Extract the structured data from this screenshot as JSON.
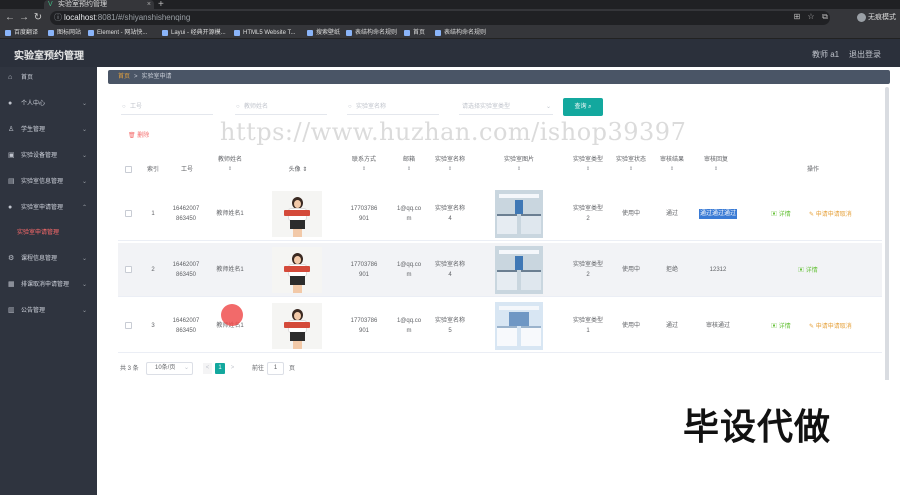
{
  "browser": {
    "tab_title": "实验室预约管理",
    "tab_close": "×",
    "new_tab": "+",
    "url_host": "localhost",
    "url_path": ":8081/#/shiyanshishenqing",
    "profile_label": "无痕模式",
    "bookmarks": [
      "百度翻译",
      "图标网站",
      "Element - 网站快...",
      "Layui - 经典开源模...",
      "HTML5 Website T...",
      "搜索壁纸",
      "表结构命名规则",
      "首页",
      "表结构命名规则"
    ]
  },
  "header": {
    "app_title": "实验室预约管理",
    "user_name": "教师 a1",
    "logout": "退出登录"
  },
  "sidebar": {
    "items": [
      {
        "label": "首页",
        "icon": "home-icon"
      },
      {
        "label": "个人中心",
        "icon": "user-icon"
      },
      {
        "label": "学生管理",
        "icon": "student-icon"
      },
      {
        "label": "实验设备管理",
        "icon": "device-icon"
      },
      {
        "label": "实验室信息管理",
        "icon": "lab-info-icon"
      },
      {
        "label": "实验室申请管理",
        "icon": "lab-apply-icon"
      },
      {
        "label": "课程信息管理",
        "icon": "course-icon"
      },
      {
        "label": "排课取消申请管理",
        "icon": "cancel-icon"
      },
      {
        "label": "公告管理",
        "icon": "notice-icon"
      }
    ],
    "active_sub": "实验室申请管理"
  },
  "breadcrumb": {
    "home": "首页",
    "sep": ">",
    "current": "实验室申请"
  },
  "filters": {
    "job_no": "工号",
    "teacher_name": "教师姓名",
    "lab_name": "实验室名称",
    "lab_type": "请选择实验室类型",
    "search_btn": "查询"
  },
  "toolbar": {
    "delete": "删除"
  },
  "table": {
    "columns": [
      "索引",
      "工号",
      "教师姓名",
      "头像",
      "联系方式",
      "邮箱",
      "实验室名称",
      "实验室图片",
      "实验室类型",
      "实验室状态",
      "审核结果",
      "审核回复",
      "操作"
    ],
    "rows": [
      {
        "index": "1",
        "job_no_a": "16462007",
        "job_no_b": "863450",
        "teacher": "教师姓名1",
        "phone_a": "17703786",
        "phone_b": "901",
        "email_a": "1@qq.co",
        "email_b": "m",
        "lab_a": "实验室名称",
        "lab_b": "4",
        "type_a": "实验室类型",
        "type_b": "2",
        "status": "使用中",
        "result": "通过",
        "reply": "通过通过通过",
        "edit": "详情",
        "apply": "申请申请取消"
      },
      {
        "index": "2",
        "job_no_a": "16462007",
        "job_no_b": "863450",
        "teacher": "教师姓名1",
        "phone_a": "17703786",
        "phone_b": "901",
        "email_a": "1@qq.co",
        "email_b": "m",
        "lab_a": "实验室名称",
        "lab_b": "4",
        "type_a": "实验室类型",
        "type_b": "2",
        "status": "使用中",
        "result": "拒绝",
        "reply": "12312",
        "edit": "详情",
        "apply": ""
      },
      {
        "index": "3",
        "job_no_a": "16462007",
        "job_no_b": "863450",
        "teacher": "教师姓名1",
        "phone_a": "17703786",
        "phone_b": "901",
        "email_a": "1@qq.co",
        "email_b": "m",
        "lab_a": "实验室名称",
        "lab_b": "5",
        "type_a": "实验室类型",
        "type_b": "1",
        "status": "使用中",
        "result": "通过",
        "reply": "审核通过",
        "edit": "详情",
        "apply": "申请申请取消"
      }
    ],
    "sort_mark": "⇕"
  },
  "pagination": {
    "total": "共 3 条",
    "page_size": "10条/页",
    "prev": "<",
    "current_page": "1",
    "next": ">",
    "goto": "前往",
    "goto_value": "1",
    "page_unit": "页"
  },
  "overlays": {
    "watermark": "https://www.huzhan.com/ishop39397",
    "promo": "毕设代做"
  }
}
